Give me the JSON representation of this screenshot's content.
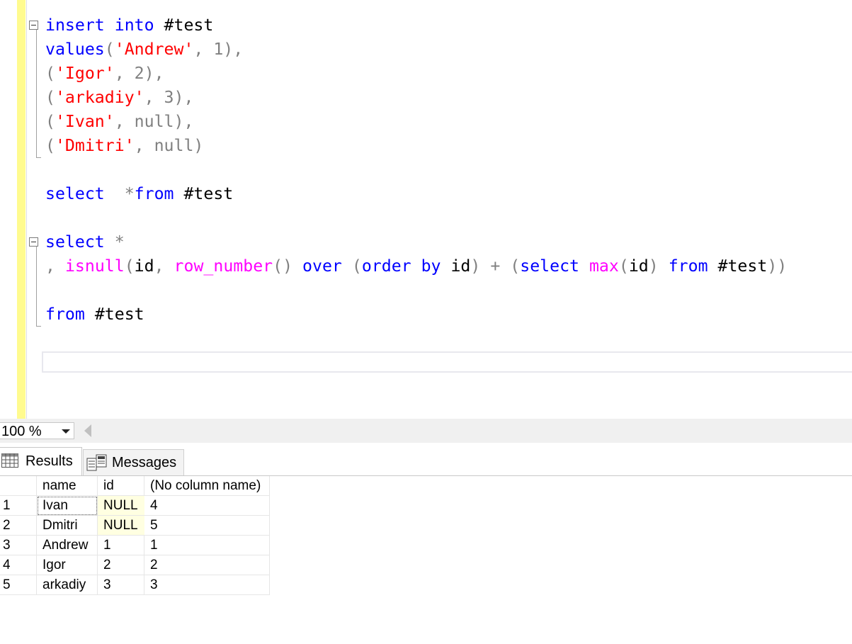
{
  "editor": {
    "lines": [
      [
        "insert",
        "into",
        "#test"
      ],
      [
        "values",
        "(",
        "'Andrew'",
        ", 1),"
      ],
      [
        "(",
        "'Igor'",
        ", 2),"
      ],
      [
        "(",
        "'arkadiy'",
        ", 3),"
      ],
      [
        "(",
        "'Ivan'",
        ", ",
        "null",
        "),"
      ],
      [
        "(",
        "'Dmitri'",
        ", ",
        "null",
        ")"
      ],
      [
        "select",
        "*",
        "from",
        "#test"
      ],
      [
        "select",
        "*"
      ],
      [
        ",",
        "isnull",
        "(id,",
        "row_number",
        "()",
        "over",
        "(",
        "order by",
        "id)",
        "+",
        "(",
        "select",
        "max",
        "(id)",
        "from",
        "#test))"
      ],
      [
        "from",
        "#test"
      ]
    ]
  },
  "zoom": {
    "value": "100 %"
  },
  "tabs": {
    "results_label": "Results",
    "messages_label": "Messages"
  },
  "results": {
    "columns": [
      "name",
      "id",
      "(No column name)"
    ],
    "rows": [
      {
        "num": "1",
        "name": "Ivan",
        "id": "NULL",
        "calc": "4"
      },
      {
        "num": "2",
        "name": "Dmitri",
        "id": "NULL",
        "calc": "5"
      },
      {
        "num": "3",
        "name": "Andrew",
        "id": "1",
        "calc": "1"
      },
      {
        "num": "4",
        "name": "Igor",
        "id": "2",
        "calc": "2"
      },
      {
        "num": "5",
        "name": "arkadiy",
        "id": "3",
        "calc": "3"
      }
    ]
  },
  "colors": {
    "keyword": "#0000ff",
    "string": "#ff0000",
    "function": "#ff00ff",
    "operator": "#808080",
    "margin": "#fffb8f",
    "null_cell": "#ffffe1"
  }
}
